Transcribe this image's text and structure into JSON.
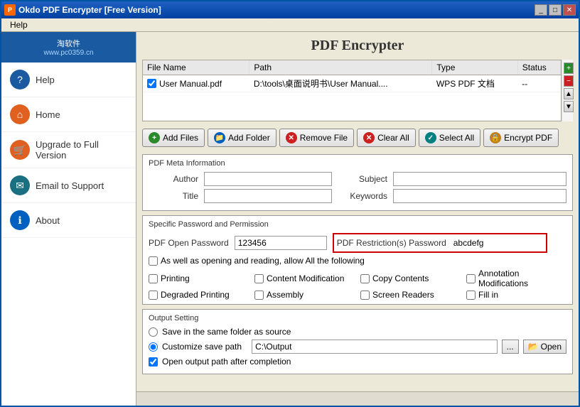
{
  "window": {
    "title": "Okdo PDF Encrypter [Free Version]",
    "icon": "pdf"
  },
  "menu": {
    "items": [
      "Help"
    ]
  },
  "sidebar": {
    "logo": {
      "text": "淘软件",
      "url": "www.pc0359.cn"
    },
    "items": [
      {
        "id": "help",
        "label": "Help",
        "icon": "?"
      },
      {
        "id": "home",
        "label": "Home",
        "icon": "⌂"
      },
      {
        "id": "upgrade",
        "label": "Upgrade to Full Version",
        "icon": "🛒"
      },
      {
        "id": "email",
        "label": "Email to Support",
        "icon": "✉"
      },
      {
        "id": "about",
        "label": "About",
        "icon": "ℹ"
      }
    ]
  },
  "page": {
    "title": "PDF Encrypter"
  },
  "file_table": {
    "columns": [
      "File Name",
      "Path",
      "Type",
      "Status"
    ],
    "rows": [
      {
        "checked": true,
        "name": "User Manual.pdf",
        "path": "D:\\tools\\桌面说明书\\User Manual....",
        "type": "WPS PDF 文档",
        "status": "--"
      }
    ]
  },
  "buttons": {
    "add_files": "Add Files",
    "add_folder": "Add Folder",
    "remove_file": "Remove File",
    "clear_all": "Clear All",
    "select_all": "Select All",
    "encrypt_pdf": "Encrypt PDF"
  },
  "meta_section": {
    "title": "PDF Meta Information",
    "author_label": "Author",
    "subject_label": "Subject",
    "title_label": "Title",
    "keywords_label": "Keywords",
    "author_value": "",
    "subject_value": "",
    "title_value": "",
    "keywords_value": ""
  },
  "password_section": {
    "title": "Specific Password and Permission",
    "open_password_label": "PDF Open Password",
    "open_password_value": "123456",
    "restriction_password_label": "PDF Restriction(s) Password",
    "restriction_password_value": "abcdefg",
    "allow_label": "As well as opening and reading, allow All the following",
    "permissions": [
      "Printing",
      "Content Modification",
      "Copy Contents",
      "Annotation Modifications",
      "Degraded Printing",
      "Assembly",
      "Screen Readers",
      "Fill in"
    ]
  },
  "output_section": {
    "title": "Output Setting",
    "option1": "Save in the same folder as source",
    "option2": "Customize save path",
    "path_value": "C:\\Output",
    "browse_label": "...",
    "open_label": "Open",
    "open_after_label": "Open output path after completion"
  },
  "status_bar": {
    "text": ""
  }
}
